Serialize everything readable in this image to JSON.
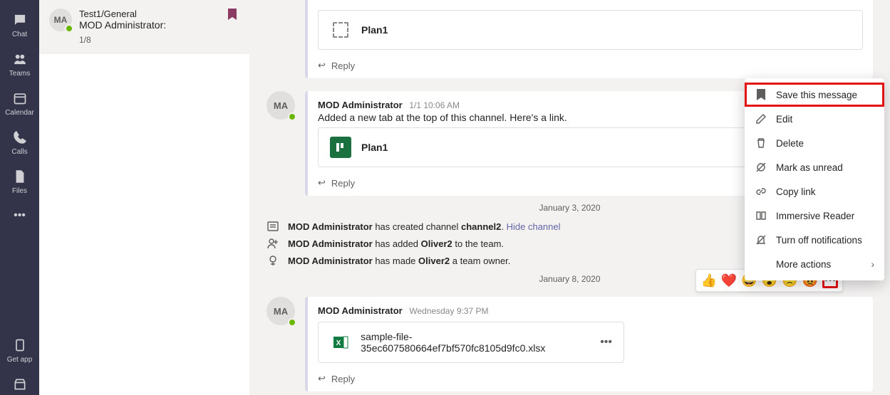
{
  "rail": {
    "items": [
      {
        "label": "Chat"
      },
      {
        "label": "Teams"
      },
      {
        "label": "Calendar"
      },
      {
        "label": "Calls"
      },
      {
        "label": "Files"
      }
    ],
    "getapp": "Get app"
  },
  "list": {
    "conv": {
      "avatar": "MA",
      "title": "Test1/General",
      "preview": "MOD Administrator:",
      "count": "1/8"
    }
  },
  "messages": {
    "m1": {
      "card_title": "Plan1",
      "reply": "Reply"
    },
    "m2": {
      "avatar": "MA",
      "name": "MOD Administrator",
      "ts": "1/1 10:06 AM",
      "text": "Added a new tab at the top of this channel. Here's a link.",
      "card_title": "Plan1",
      "reply": "Reply"
    },
    "date1": "January 3, 2020",
    "s1a": "MOD Administrator",
    "s1b": " has created channel ",
    "s1c": "channel2",
    "s1d": ". ",
    "s1e": "Hide channel",
    "s2a": "MOD Administrator",
    "s2b": " has added ",
    "s2c": "Oliver2",
    "s2d": " to the team.",
    "s3a": "MOD Administrator",
    "s3b": " has made ",
    "s3c": "Oliver2",
    "s3d": " a team owner.",
    "date2": "January 8, 2020",
    "m3": {
      "avatar": "MA",
      "name": "MOD Administrator",
      "ts": "Wednesday 9:37 PM",
      "file": "sample-file-35ec607580664ef7bf570fc8105d9fc0.xlsx",
      "reply": "Reply"
    }
  },
  "reactions": {
    "r0": "👍",
    "r1": "❤️",
    "r2": "😄",
    "r3": "😮",
    "r4": "🙁",
    "r5": "😡",
    "more": "•••"
  },
  "menu": {
    "save": "Save this message",
    "edit": "Edit",
    "delete": "Delete",
    "unread": "Mark as unread",
    "copy": "Copy link",
    "reader": "Immersive Reader",
    "notif": "Turn off notifications",
    "more": "More actions"
  }
}
